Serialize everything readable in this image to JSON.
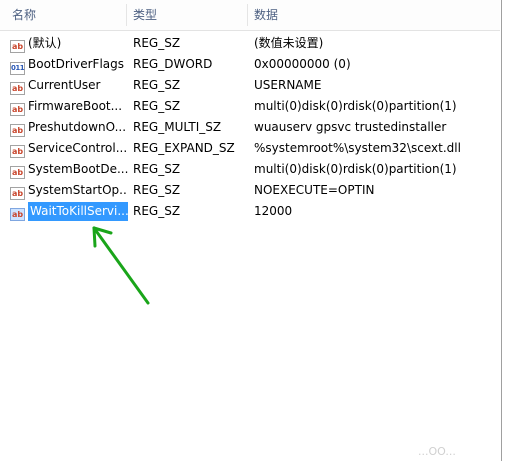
{
  "columns": {
    "name": "名称",
    "type": "类型",
    "data": "数据"
  },
  "rows": [
    {
      "icon": "string-value-icon",
      "icon_glyph": "ab",
      "name": "(默认)",
      "type": "REG_SZ",
      "data": "(数值未设置)"
    },
    {
      "icon": "binary-value-icon",
      "icon_glyph": "011",
      "name": "BootDriverFlags",
      "type": "REG_DWORD",
      "data": "0x00000000 (0)"
    },
    {
      "icon": "string-value-icon",
      "icon_glyph": "ab",
      "name": "CurrentUser",
      "type": "REG_SZ",
      "data": "USERNAME"
    },
    {
      "icon": "string-value-icon",
      "icon_glyph": "ab",
      "name": "FirmwareBoot...",
      "type": "REG_SZ",
      "data": "multi(0)disk(0)rdisk(0)partition(1)"
    },
    {
      "icon": "string-value-icon",
      "icon_glyph": "ab",
      "name": "PreshutdownO...",
      "type": "REG_MULTI_SZ",
      "data": "wuauserv gpsvc trustedinstaller"
    },
    {
      "icon": "string-value-icon",
      "icon_glyph": "ab",
      "name": "ServiceControl...",
      "type": "REG_EXPAND_SZ",
      "data": "%systemroot%\\system32\\scext.dll"
    },
    {
      "icon": "string-value-icon",
      "icon_glyph": "ab",
      "name": "SystemBootDe...",
      "type": "REG_SZ",
      "data": "multi(0)disk(0)rdisk(0)partition(1)"
    },
    {
      "icon": "string-value-icon",
      "icon_glyph": "ab",
      "name": "SystemStartOp...",
      "type": "REG_SZ",
      "data": " NOEXECUTE=OPTIN"
    },
    {
      "icon": "string-value-icon",
      "icon_glyph": "ab",
      "name": "WaitToKillServi...",
      "type": "REG_SZ",
      "data": "12000",
      "selected": true
    }
  ],
  "colors": {
    "selection": "#3399ff",
    "header_text": "#4d6082",
    "arrow": "#1aa51a"
  },
  "watermark": "...OO..."
}
